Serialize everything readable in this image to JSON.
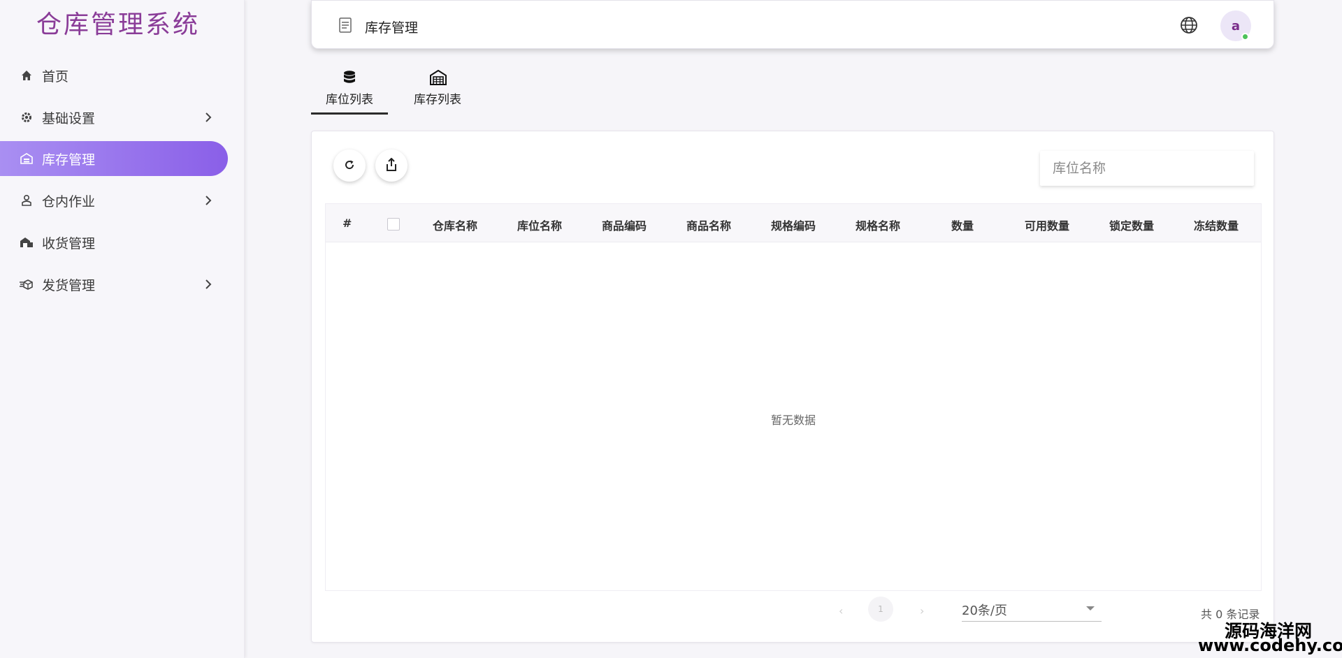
{
  "app": {
    "title": "仓库管理系统"
  },
  "sidebar": {
    "items": [
      {
        "label": "首页",
        "icon": "home-icon",
        "has_children": false,
        "active": false
      },
      {
        "label": "基础设置",
        "icon": "gear-icon",
        "has_children": true,
        "active": false
      },
      {
        "label": "库存管理",
        "icon": "warehouse-icon",
        "has_children": false,
        "active": true
      },
      {
        "label": "仓内作业",
        "icon": "worker-icon",
        "has_children": true,
        "active": false
      },
      {
        "label": "收货管理",
        "icon": "receiving-icon",
        "has_children": false,
        "active": false
      },
      {
        "label": "发货管理",
        "icon": "shipping-icon",
        "has_children": true,
        "active": false
      }
    ]
  },
  "header": {
    "title": "库存管理",
    "avatar_letter": "a"
  },
  "tabs": [
    {
      "label": "库位列表",
      "icon": "database-icon",
      "active": true
    },
    {
      "label": "库存列表",
      "icon": "warehouse-icon",
      "active": false
    }
  ],
  "toolbar": {
    "search_placeholder": "库位名称"
  },
  "table": {
    "columns": [
      "#",
      "仓库名称",
      "库位名称",
      "商品编码",
      "商品名称",
      "规格编码",
      "规格名称",
      "数量",
      "可用数量",
      "锁定数量",
      "冻结数量"
    ],
    "rows": [],
    "empty_text": "暂无数据"
  },
  "pagination": {
    "current_page": "1",
    "page_size": "20条/页",
    "total": "共 0 条记录"
  },
  "watermark": {
    "line1": "源码海洋网",
    "line2": "www.codehy.com"
  },
  "colors": {
    "accent": "#8a5fe8",
    "title": "#8a3c98",
    "online": "#4cc25a"
  }
}
